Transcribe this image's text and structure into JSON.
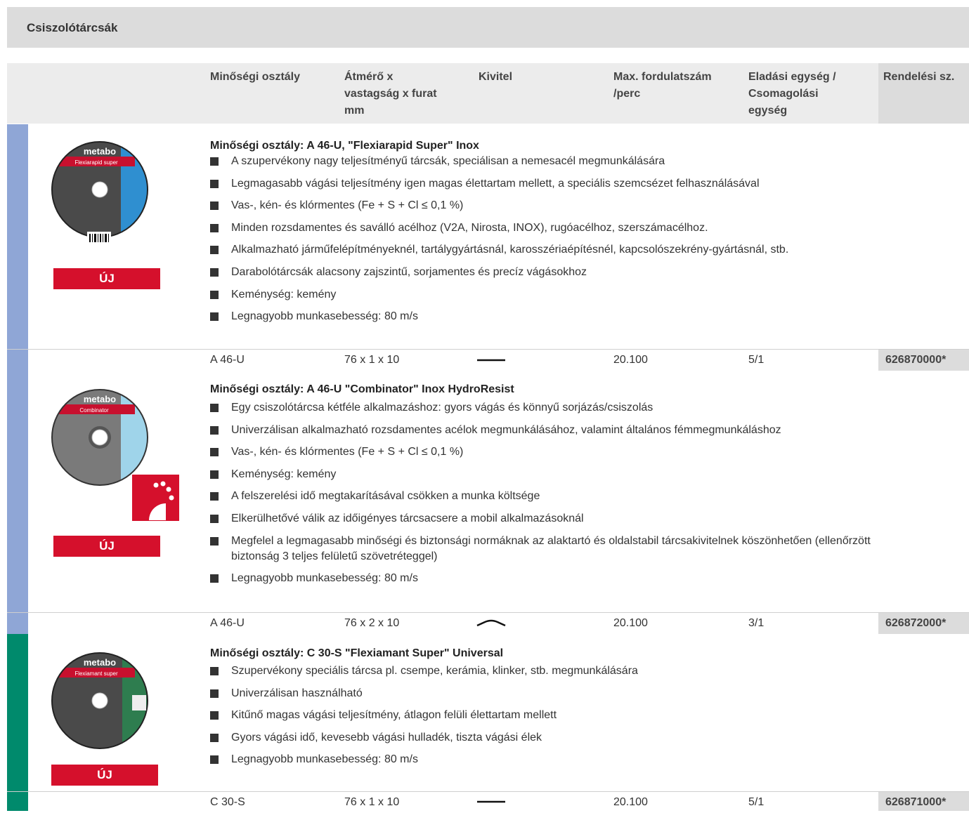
{
  "title": "Csiszolótárcsák",
  "headers": {
    "quality": "Minőségi osztály",
    "dimensions": [
      "Átmérő x",
      "vastagság x furat",
      "mm"
    ],
    "design": "Kivitel",
    "max_rpm": [
      "Max. fordulatszám",
      "/perc"
    ],
    "sales_unit": [
      "Eladási egység /",
      "Csomagolási",
      "egység"
    ],
    "order_no": "Rendelési sz."
  },
  "colors": {
    "blue_stripe": "#8fa6d6",
    "green_stripe": "#008a6c",
    "badge_red": "#d5102c"
  },
  "products": [
    {
      "brand": "metabo",
      "disc_label": "Flexiarapid super",
      "badge": "ÚJ",
      "title": "Minőségi osztály: A 46-U, \"Flexiarapid Super\" Inox",
      "bullets": [
        "A szupervékony nagy teljesítményű tárcsák, speciálisan a nemesacél megmunkálására",
        " Legmagasabb vágási teljesítmény igen magas élettartam mellett, a speciális szemcsézet felhasználásával",
        "Vas-, kén- és klórmentes (Fe + S + Cl ≤ 0,1 %)",
        "Minden rozsdamentes és saválló acélhoz (V2A, Nirosta, INOX), rugóacélhoz, szerszámacélhoz.",
        "Alkalmazható járműfelépítményeknél, tartálygyártásnál, karosszériaépítésnél, kapcsolószekrény-gyártásnál, stb.",
        "Darabolótárcsák alacsony zajszintű, sorjamentes és precíz vágásokhoz",
        "Keménység: kemény",
        "Legnagyobb munkasebesség: 80 m/s"
      ],
      "spec": {
        "quality": "A 46-U",
        "dimensions": "76 x 1 x 10",
        "design_icon": "flat-disc-icon",
        "max_rpm": "20.100",
        "sales_unit": "5/1",
        "order_no": "626870000*"
      }
    },
    {
      "brand": "metabo",
      "disc_label": "Combinator",
      "badge": "ÚJ",
      "title": "Minőségi osztály: A 46-U \"Combinator\" Inox HydroResist",
      "bullets": [
        "Egy csiszolótárcsa kétféle alkalmazáshoz: gyors vágás és könnyű sorjázás/csiszolás",
        "Univerzálisan alkalmazható rozsdamentes acélok megmunkálásához, valamint általános fémmegmunkáláshoz",
        "Vas-, kén- és klórmentes (Fe + S + Cl ≤ 0,1 %)",
        "Keménység: kemény",
        "A felszerelési idő megtakarításával csökken a munka költsége",
        "Elkerülhetővé válik az időigényes tárcsacsere a mobil alkalmazásoknál",
        "Megfelel a legmagasabb minőségi és biztonsági normáknak az alaktartó és oldalstabil tárcsakivitelnek köszönhetően (ellenőrzött biztonság 3 teljes felületű szövetréteggel)",
        "Legnagyobb munkasebesség: 80 m/s"
      ],
      "spec": {
        "quality": "A 46-U",
        "dimensions": "76 x 2 x 10",
        "design_icon": "depressed-center-disc-icon",
        "max_rpm": "20.100",
        "sales_unit": "3/1",
        "order_no": "626872000*"
      }
    },
    {
      "brand": "metabo",
      "disc_label": "Flexiamant super",
      "badge": "ÚJ",
      "title": "Minőségi osztály: C 30-S \"Flexiamant Super\" Universal",
      "bullets": [
        "Szupervékony speciális tárcsa pl. csempe, kerámia, klinker, stb. megmunkálására",
        "Univerzálisan használható",
        "Kitűnő magas vágási teljesítmény, átlagon felüli élettartam mellett",
        "Gyors vágási idő, kevesebb vágási hulladék, tiszta vágási élek",
        "Legnagyobb munkasebesség: 80 m/s"
      ],
      "spec": {
        "quality": "C 30-S",
        "dimensions": "76 x 1 x 10",
        "design_icon": "flat-disc-icon",
        "max_rpm": "20.100",
        "sales_unit": "5/1",
        "order_no": "626871000*"
      }
    }
  ]
}
